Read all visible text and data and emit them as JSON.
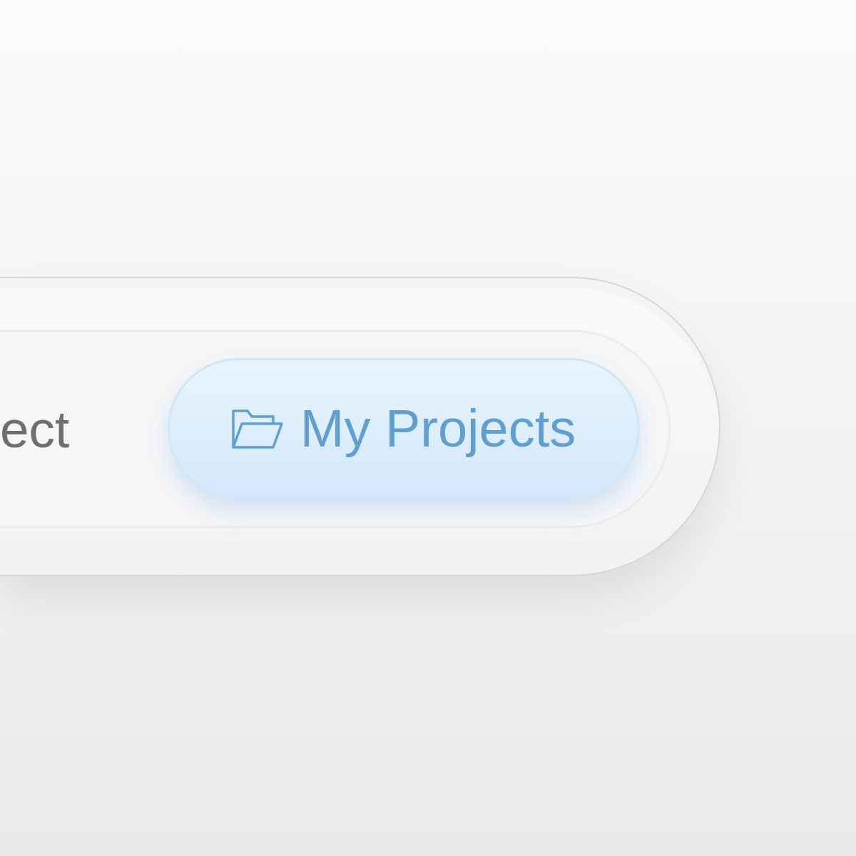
{
  "segments": [
    {
      "kind": "label",
      "label": "ect",
      "selected": false
    },
    {
      "kind": "icon-label",
      "label": "My Projects",
      "selected": true
    }
  ]
}
